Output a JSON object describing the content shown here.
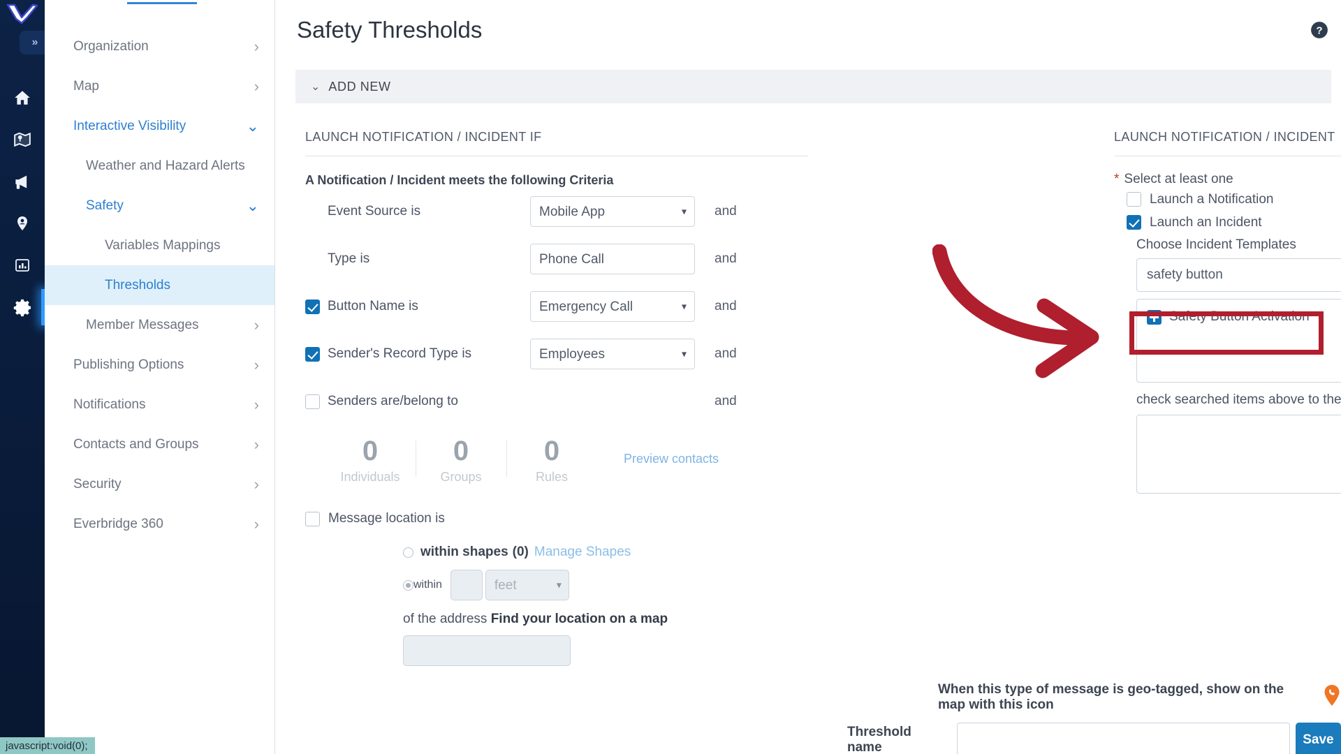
{
  "rail": {
    "logo_name": "everbridge-logo",
    "expand_label": "»",
    "icons": [
      {
        "name": "home-icon",
        "label": "Home"
      },
      {
        "name": "map-icon",
        "label": "Map"
      },
      {
        "name": "megaphone-icon",
        "label": "Notifications"
      },
      {
        "name": "contact-pin-icon",
        "label": "Contacts"
      },
      {
        "name": "reports-icon",
        "label": "Reports"
      },
      {
        "name": "gear-icon",
        "label": "Settings",
        "active": true
      }
    ]
  },
  "sidebar": {
    "items": [
      {
        "label": "Organization",
        "level": 1,
        "chevron": "right",
        "state": "normal"
      },
      {
        "label": "Map",
        "level": 1,
        "chevron": "right",
        "state": "normal"
      },
      {
        "label": "Interactive Visibility",
        "level": 1,
        "chevron": "down",
        "state": "blue"
      },
      {
        "label": "Weather and Hazard Alerts",
        "level": 2,
        "chevron": "",
        "state": "normal"
      },
      {
        "label": "Safety",
        "level": 2,
        "chevron": "down",
        "state": "blue"
      },
      {
        "label": "Variables Mappings",
        "level": 3,
        "chevron": "",
        "state": "normal"
      },
      {
        "label": "Thresholds",
        "level": 3,
        "chevron": "",
        "state": "selected"
      },
      {
        "label": "Member Messages",
        "level": 2,
        "chevron": "right",
        "state": "normal"
      },
      {
        "label": "Publishing Options",
        "level": 1,
        "chevron": "right",
        "state": "normal"
      },
      {
        "label": "Notifications",
        "level": 1,
        "chevron": "right",
        "state": "normal"
      },
      {
        "label": "Contacts and Groups",
        "level": 1,
        "chevron": "right",
        "state": "normal"
      },
      {
        "label": "Security",
        "level": 1,
        "chevron": "right",
        "state": "normal"
      },
      {
        "label": "Everbridge 360",
        "level": 1,
        "chevron": "right",
        "state": "normal"
      }
    ]
  },
  "header": {
    "title": "Safety Thresholds",
    "help_icon": "help-circle-icon",
    "add_new_label": "ADD NEW",
    "add_new_chevron": "⌄"
  },
  "left_panel": {
    "section_title": "LAUNCH NOTIFICATION / INCIDENT IF",
    "criteria_heading": "A Notification / Incident meets the following Criteria",
    "and_label": "and",
    "rows": [
      {
        "label": "Event Source is",
        "checkbox": "none",
        "value": "Mobile App",
        "caret": true
      },
      {
        "label": "Type is",
        "checkbox": "none",
        "value": "Phone Call",
        "caret": false
      },
      {
        "label": "Button Name is",
        "checkbox": "checked",
        "value": "Emergency Call",
        "caret": true
      },
      {
        "label": "Sender's Record Type is",
        "checkbox": "checked",
        "value": "Employees",
        "caret": true
      },
      {
        "label": "Senders are/belong to",
        "checkbox": "unchecked",
        "value": "",
        "caret": false
      }
    ],
    "counters": [
      {
        "value": "0",
        "label": "Individuals"
      },
      {
        "value": "0",
        "label": "Groups"
      },
      {
        "value": "0",
        "label": "Rules"
      }
    ],
    "preview_contacts": "Preview contacts",
    "message_location_label": "Message location is",
    "message_location_checked": false,
    "within_shapes_label": "within shapes",
    "within_shapes_count": "(0)",
    "manage_shapes_link": "Manage Shapes",
    "within_label": "within",
    "within_value": "",
    "unit_value": "feet",
    "of_the_address_label": "of the address",
    "find_location_link": "Find your location on a map",
    "address_value": ""
  },
  "right_panel": {
    "section_title": "LAUNCH NOTIFICATION / INCIDENT",
    "required_mark": "*",
    "select_at_least_one": "Select at least one",
    "launch_notification_label": "Launch a Notification",
    "launch_notification_checked": false,
    "launch_incident_label": "Launch an Incident",
    "launch_incident_checked": true,
    "choose_templates_label": "Choose Incident Templates",
    "search_value": "safety button",
    "search_icon": "search-icon",
    "result_item": "Safety Button Activation",
    "hint": "check searched items above to the select box below."
  },
  "footer": {
    "geo_text": "When this type of message is geo-tagged, show on the map with this icon",
    "pin_icon": "phone-map-pin-icon",
    "threshold_name_label": "Threshold name",
    "threshold_name_value": "",
    "save_label": "Save"
  },
  "status_bar": {
    "text": "javascript:void(0);"
  },
  "colors": {
    "accent_blue": "#1071b5",
    "link_blue": "#2e7fd0",
    "selected_bg": "#dff0fb",
    "annotation_red": "#b01f2e",
    "pin_orange": "#f07524",
    "rail_dark": "#0c2246"
  }
}
